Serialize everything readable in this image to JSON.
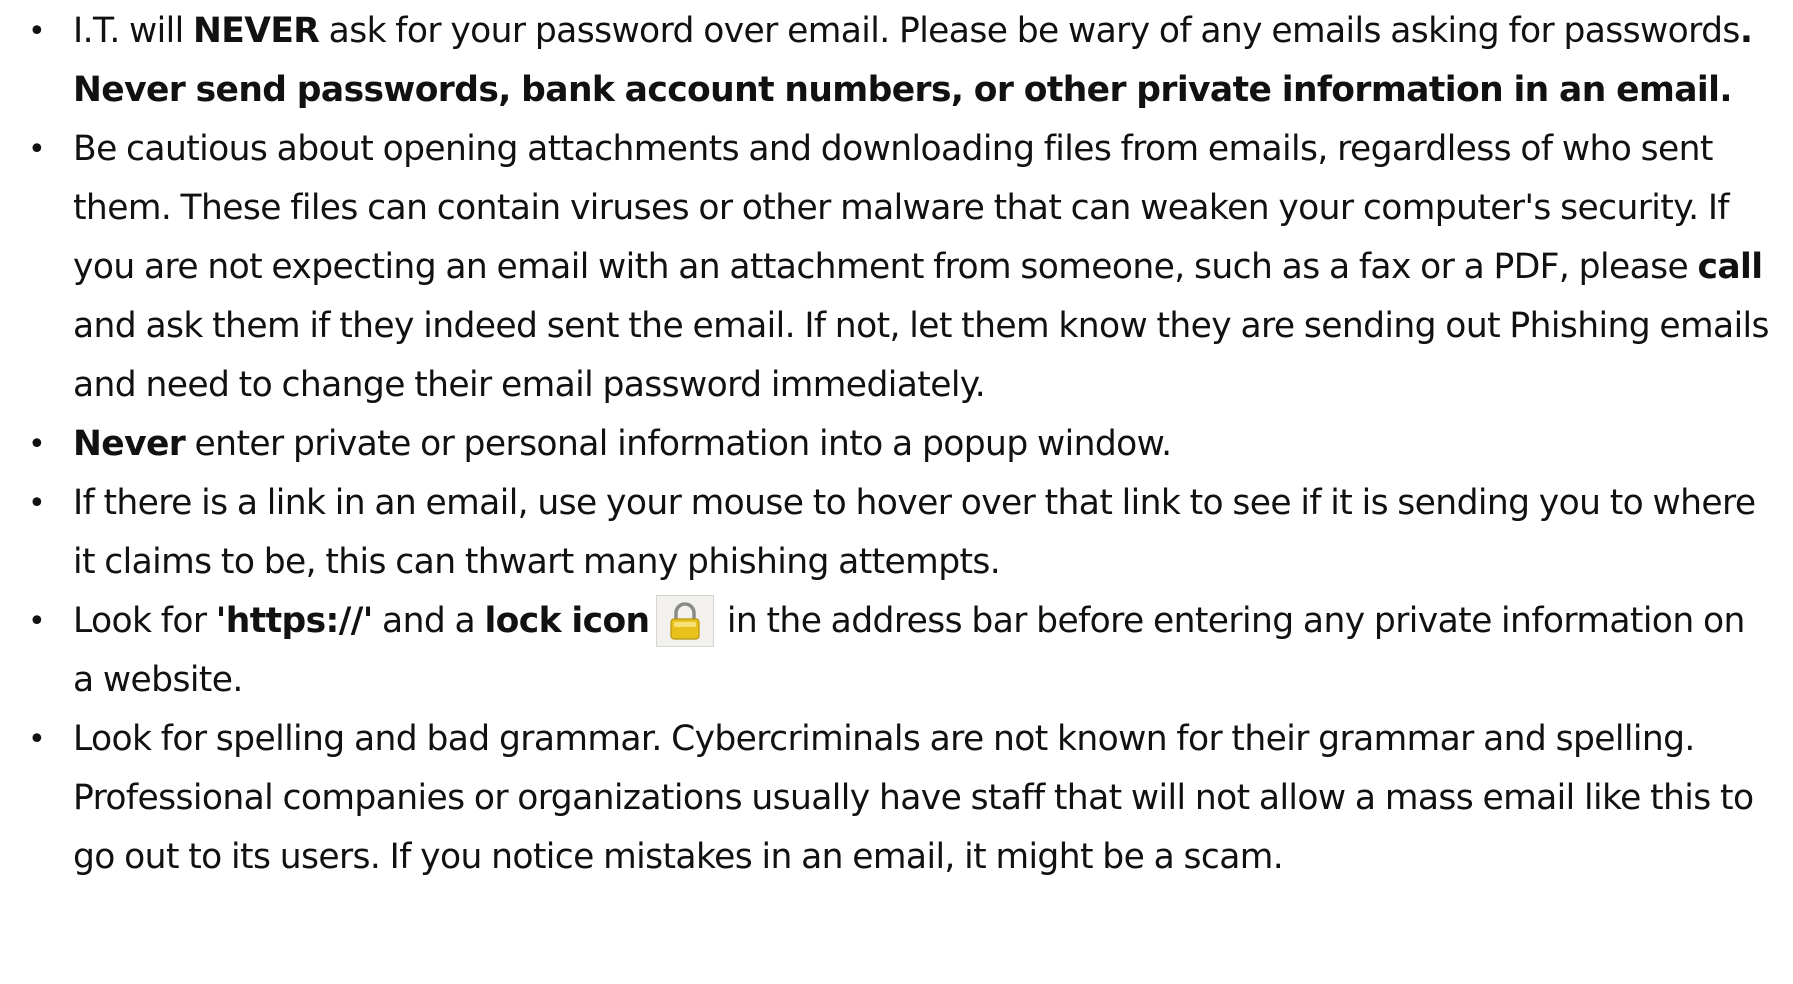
{
  "tips": [
    {
      "bullet": "•",
      "segments": [
        {
          "text": "I.T. will ",
          "bold": false
        },
        {
          "text": "NEVER",
          "bold": true
        },
        {
          "text": " ask for your password over email. Please be wary of any emails asking for passwords",
          "bold": false
        },
        {
          "text": ". Never send passwords, bank account numbers, or other private information in an email.",
          "bold": true
        }
      ]
    },
    {
      "bullet": "•",
      "segments": [
        {
          "text": "Be cautious about opening attachments and downloading files from emails, regardless of who sent them. These files can contain viruses or other malware that can weaken your computer's security. If you are not expecting an email with an attachment from someone, such as a fax or a PDF, please ",
          "bold": false
        },
        {
          "text": "call",
          "bold": true
        },
        {
          "text": " and ask them if they indeed sent the email. If not, let them know they are sending out Phishing emails and need to change their email password immediately.",
          "bold": false
        }
      ]
    },
    {
      "bullet": "•",
      "segments": [
        {
          "text": "Never",
          "bold": true
        },
        {
          "text": " enter private or personal information into a popup window.",
          "bold": false
        }
      ]
    },
    {
      "bullet": "•",
      "segments": [
        {
          "text": "If there is a link in an email, use your mouse to hover over that link to see if it is sending you to where it claims to be, this can thwart many phishing attempts.",
          "bold": false
        }
      ]
    },
    {
      "bullet": "•",
      "segments": [
        {
          "text": "Look for ",
          "bold": false
        },
        {
          "text": "'https://'",
          "bold": true
        },
        {
          "text": " and a ",
          "bold": false
        },
        {
          "text": "lock icon",
          "bold": true
        },
        {
          "icon": "lock-icon"
        },
        {
          "text": " in the address bar before entering any private information on a website.",
          "bold": false
        }
      ]
    },
    {
      "bullet": "•",
      "segments": [
        {
          "text": "Look for spelling and bad grammar. Cybercriminals are not known for their grammar and spelling. Professional companies or organizations usually have staff that will not allow a mass email like this to go out to its users. If you notice mistakes in an email, it might be a scam.",
          "bold": false
        }
      ]
    }
  ],
  "colors": {
    "text": "#111111",
    "background": "#ffffff",
    "lock_body": "#e8c21a",
    "lock_shackle": "#8a8a8a",
    "icon_frame": "#f2f1ee"
  }
}
